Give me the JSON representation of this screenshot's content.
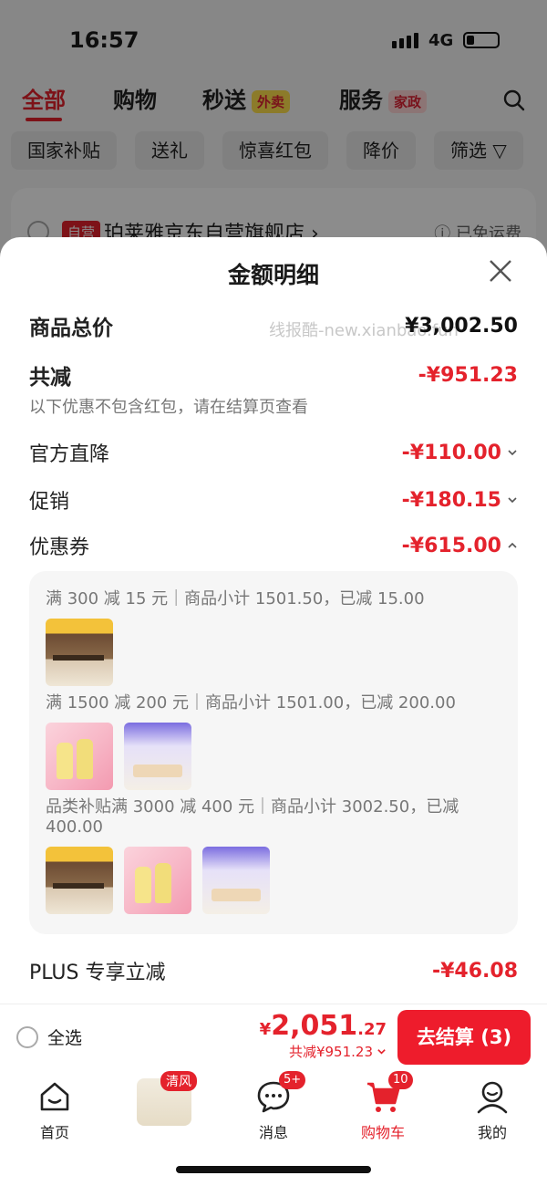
{
  "status": {
    "time": "16:57",
    "network": "4G"
  },
  "top_tabs": [
    {
      "label": "全部"
    },
    {
      "label": "购物"
    },
    {
      "label": "秒送",
      "tag": "外卖"
    },
    {
      "label": "服务",
      "tag": "家政"
    }
  ],
  "filters": [
    "国家补贴",
    "送礼",
    "惊喜红包",
    "降价",
    "筛选"
  ],
  "store": {
    "badge": "自营",
    "name": "珀莱雅京东自营旗舰店",
    "shipping": "已免运费"
  },
  "sheet": {
    "title": "金额明细",
    "watermark": "线报酷-new.xianbao.fun",
    "goods_total_label": "商品总价",
    "goods_total_value": "¥3,002.50",
    "total_discount_label": "共减",
    "total_discount_value": "-¥951.23",
    "note": "以下优惠不包含红包，请在结算页查看",
    "official_label": "官方直降",
    "official_value": "-¥110.00",
    "promo_label": "促销",
    "promo_value": "-¥180.15",
    "coupon_label": "优惠券",
    "coupon_value": "-¥615.00",
    "coupons": [
      {
        "text": "满 300 减 15 元｜商品小计 1501.50，已减 15.00",
        "thumbs": [
          "desk"
        ]
      },
      {
        "text": "满 1500 减 200 元｜商品小计 1501.00，已减 200.00",
        "thumbs": [
          "lotion",
          "razor"
        ]
      },
      {
        "text": "品类补贴满 3000 减 400 元｜商品小计 3002.50，已减 400.00",
        "thumbs": [
          "desk",
          "lotion",
          "razor"
        ]
      }
    ],
    "plus_label": "PLUS 专享立减",
    "plus_value": "-¥46.08"
  },
  "checkout": {
    "select_all": "全选",
    "currency": "¥",
    "total_int": "2,051",
    "total_dec": ".27",
    "discount_text": "共减¥951.23",
    "button": "去结算 (3)"
  },
  "tabbar": {
    "home": "首页",
    "promo_badge": "清风",
    "messages": "消息",
    "messages_badge": "5+",
    "cart": "购物车",
    "cart_badge": "10",
    "mine": "我的"
  },
  "colors": {
    "accent": "#e4222c",
    "button": "#ee1c2c"
  }
}
